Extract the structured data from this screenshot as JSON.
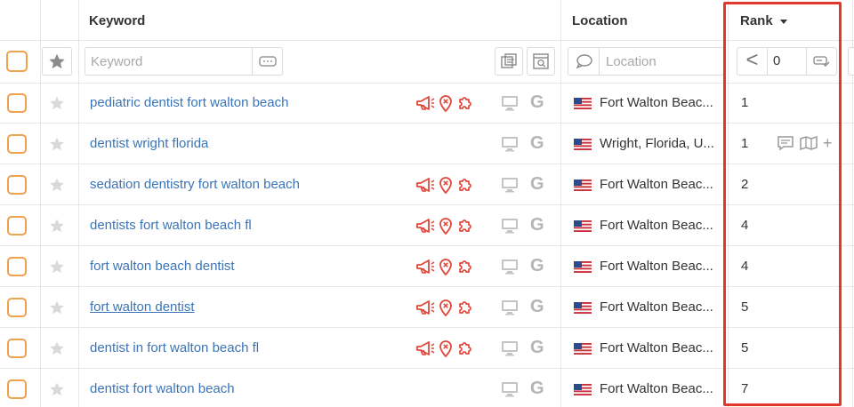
{
  "columns": {
    "keyword": "Keyword",
    "location": "Location",
    "rank": "Rank"
  },
  "filters": {
    "keyword_placeholder": "Keyword",
    "location_placeholder": "Location",
    "rank_operator": "<",
    "rank_value": "0"
  },
  "colors": {
    "accent_orange": "#f0a14d",
    "keyword_link": "#3a74b8",
    "feature_red": "#e0483b",
    "highlight_red": "#e2372b"
  },
  "rows": [
    {
      "keyword": "pediatric dentist fort walton beach",
      "location": "Fort Walton Beac...",
      "rank": "1",
      "features": true,
      "underlined": false,
      "tools": false
    },
    {
      "keyword": "dentist wright florida",
      "location": "Wright, Florida, U...",
      "rank": "1",
      "features": false,
      "underlined": false,
      "tools": true
    },
    {
      "keyword": "sedation dentistry fort walton beach",
      "location": "Fort Walton Beac...",
      "rank": "2",
      "features": true,
      "underlined": false,
      "tools": false
    },
    {
      "keyword": "dentists fort walton beach fl",
      "location": "Fort Walton Beac...",
      "rank": "4",
      "features": true,
      "underlined": false,
      "tools": false
    },
    {
      "keyword": "fort walton beach dentist",
      "location": "Fort Walton Beac...",
      "rank": "4",
      "features": true,
      "underlined": false,
      "tools": false
    },
    {
      "keyword": "fort walton dentist",
      "location": "Fort Walton Beac...",
      "rank": "5",
      "features": true,
      "underlined": true,
      "tools": false
    },
    {
      "keyword": "dentist in fort walton beach fl",
      "location": "Fort Walton Beac...",
      "rank": "5",
      "features": true,
      "underlined": false,
      "tools": false
    },
    {
      "keyword": "dentist fort walton beach",
      "location": "Fort Walton Beac...",
      "rank": "7",
      "features": false,
      "underlined": false,
      "tools": false
    }
  ],
  "icons": {
    "search_engine": "G",
    "device": "desktop-icon",
    "flag": "us-flag-icon"
  }
}
